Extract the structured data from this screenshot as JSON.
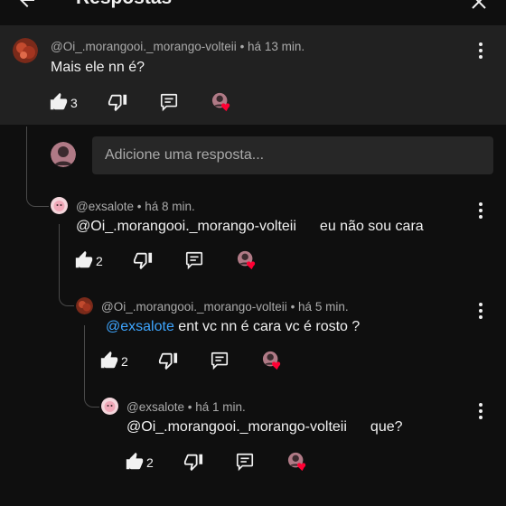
{
  "header": {
    "title": "Respostas"
  },
  "parent": {
    "author": "@Oi_.morangooi._morango-volteii",
    "time": "há 13 min.",
    "text": "Mais ele nn é?",
    "likes": "3"
  },
  "reply_input": {
    "placeholder": "Adicione uma resposta..."
  },
  "replies": [
    {
      "author": "@exsalote",
      "time": "há 8 min.",
      "mention": "@Oi_.morangooi._morango-volteii",
      "text": "eu não sou cara",
      "likes": "2"
    },
    {
      "author": "@Oi_.morangooi._morango-volteii",
      "time": "há 5 min.",
      "mention": "@exsalote",
      "text": "ent vc nn é cara vc é rosto ?",
      "likes": "2"
    },
    {
      "author": "@exsalote",
      "time": "há 1 min.",
      "mention": "@Oi_.morangooi._morango-volteii",
      "text": "que?",
      "likes": "2"
    }
  ],
  "sep": " • ",
  "colors": {
    "background": "#0f0f0f",
    "highlight": "#212121",
    "link": "#3ea6ff",
    "heart": "#ff0033"
  },
  "icons": [
    "back-arrow-icon",
    "close-icon",
    "like-icon",
    "dislike-icon",
    "reply-icon",
    "creator-heart-icon",
    "more-vert-icon"
  ]
}
